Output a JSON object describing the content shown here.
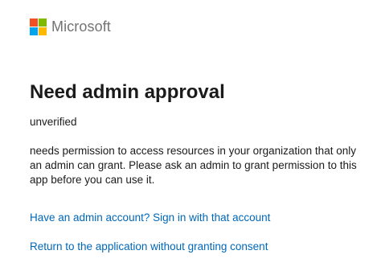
{
  "brand": {
    "name": "Microsoft",
    "logo_colors": [
      "#f25022",
      "#7fba00",
      "#00a4ef",
      "#ffb900"
    ]
  },
  "main": {
    "title": "Need admin approval",
    "subtitle": "unverified",
    "description": "needs permission to access resources in your organization that only an admin can grant. Please ask an admin to grant permission to this app before you can use it.",
    "links": {
      "admin_signin": "Have an admin account? Sign in with that account",
      "return_without_consent": "Return to the application without granting consent"
    }
  },
  "colors": {
    "link": "#0067b8",
    "text": "#1b1b1b",
    "logo_text": "#737373"
  }
}
